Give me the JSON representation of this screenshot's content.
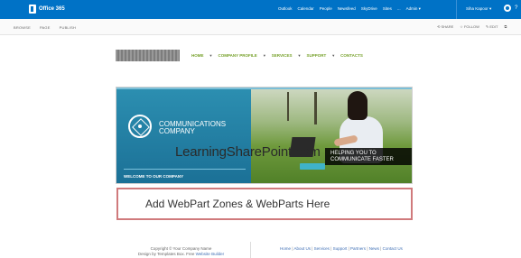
{
  "suitebar": {
    "product": "Office 365",
    "links": [
      "Outlook",
      "Calendar",
      "People",
      "Newsfeed",
      "SkyDrive",
      "Sites",
      "...",
      "Admin ▾"
    ],
    "user": "Siha Kapoor ▾",
    "help": "?"
  },
  "ribbon": {
    "tabs": [
      "BROWSE",
      "PAGE",
      "PUBLISH"
    ],
    "actions": [
      "SHARE",
      "FOLLOW",
      "EDIT"
    ]
  },
  "nav": {
    "items": [
      "HOME",
      "COMPANY PROFILE",
      "SERVICES",
      "SUPPORT",
      "CONTACTS"
    ]
  },
  "banner": {
    "company_line1": "COMMUNICATIONS",
    "company_line2": "COMPANY",
    "welcome": "WELCOME TO OUR COMPANY",
    "caption_line1": "HELPING YOU TO",
    "caption_line2": "COMMUNICATE FASTER"
  },
  "watermark": "LearningSharePoint.com",
  "webpart_zone": {
    "text": "Add WebPart Zones & WebParts Here"
  },
  "footer": {
    "copyright": "Copyright © Your Company Name",
    "design_prefix": "Design by Templates Box. Free",
    "design_link": "Website Builder",
    "links": [
      "Home",
      "About Us",
      "Services",
      "Support",
      "Partners",
      "News",
      "Contact Us"
    ]
  },
  "colors": {
    "suitebar": "#0072c6",
    "nav_text": "#76a12a",
    "banner_blue": "#1b7096",
    "zone_border": "#d07a7c"
  }
}
